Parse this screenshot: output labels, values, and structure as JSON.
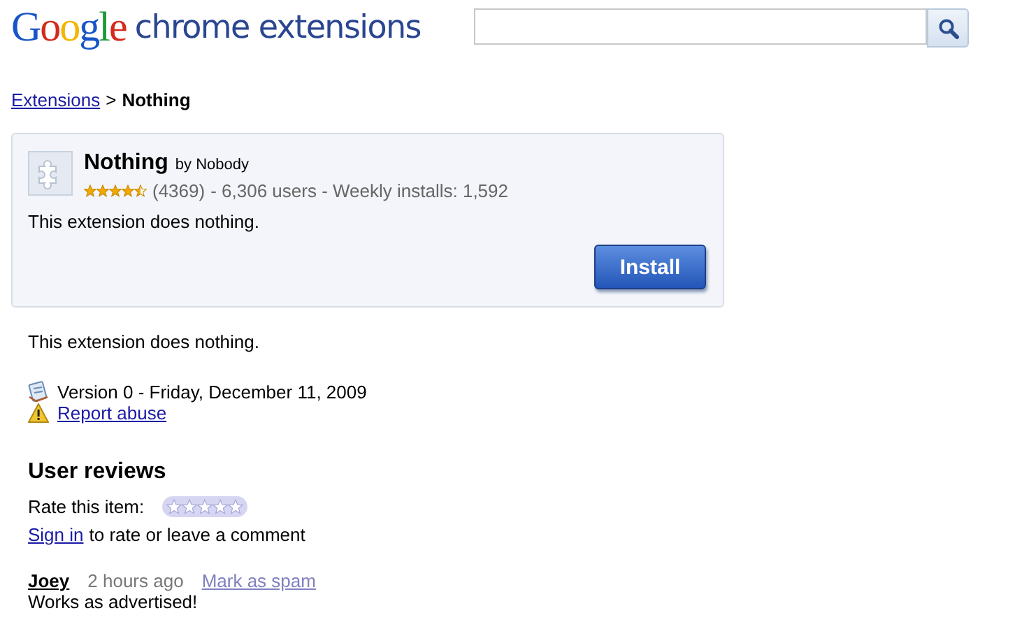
{
  "header": {
    "logo": "Google",
    "product": "chrome extensions"
  },
  "breadcrumb": {
    "link": "Extensions",
    "separator": ">",
    "current": "Nothing"
  },
  "extension": {
    "name": "Nothing",
    "author": "by Nobody",
    "stars": 4.5,
    "rating_count": "(4369)",
    "stats": "- 6,306 users - Weekly installs: 1,592",
    "summary": "This extension does nothing.",
    "install_button": "Install"
  },
  "description": "This extension does nothing.",
  "version": "Version 0 - Friday, December 11, 2009",
  "report_link": "Report abuse",
  "reviews": {
    "title": "User reviews",
    "rate_label": "Rate this item:",
    "stars": 0,
    "sign_in_link": "Sign in",
    "sign_in_text": "to rate or leave a comment",
    "items": [
      {
        "author": "Joey",
        "time": "2 hours ago",
        "spam_link": "Mark as spam",
        "text": "Works as advertised!"
      }
    ]
  }
}
